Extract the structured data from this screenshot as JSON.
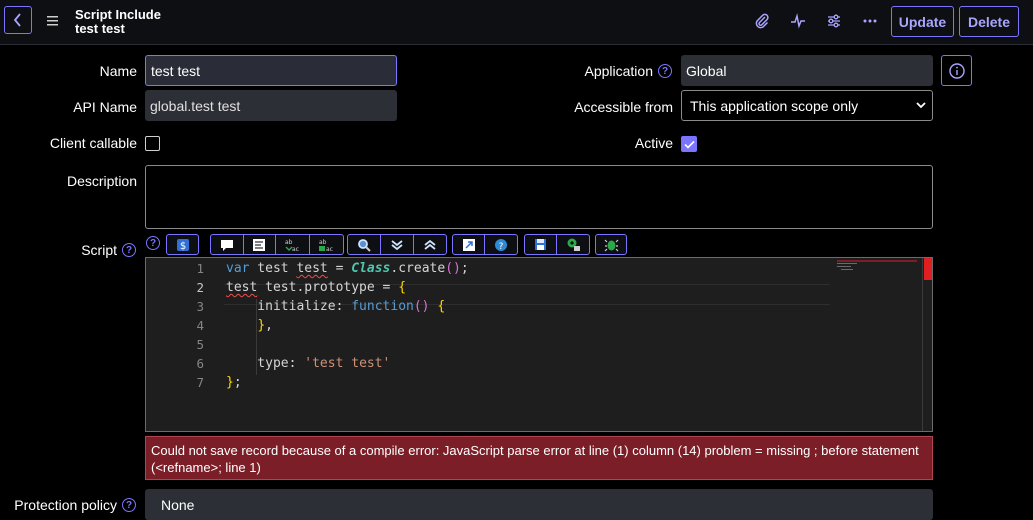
{
  "header": {
    "back_label": "Back",
    "title": "Script Include",
    "record": "test test",
    "update_label": "Update",
    "delete_label": "Delete",
    "icons": [
      "attachment-icon",
      "activity-icon",
      "settings-sliders-icon",
      "more-icon"
    ]
  },
  "form": {
    "name_label": "Name",
    "name_value": "test test",
    "api_name_label": "API Name",
    "api_name_value": "global.test test",
    "client_callable_label": "Client callable",
    "client_callable_checked": false,
    "description_label": "Description",
    "description_value": "",
    "application_label": "Application",
    "application_value": "Global",
    "accessible_from_label": "Accessible from",
    "accessible_from_value": "This application scope only",
    "active_label": "Active",
    "active_checked": true,
    "script_label": "Script",
    "protection_label": "Protection policy",
    "protection_value": "None"
  },
  "editor": {
    "lines": [
      "1",
      "2",
      "3",
      "4",
      "5",
      "6",
      "7"
    ],
    "code": [
      "var test test = Class.create();",
      "test test.prototype = {",
      "    initialize: function() {",
      "    },",
      "",
      "    type: 'test test'",
      "};"
    ]
  },
  "error": {
    "message": "Could not save record because of a compile error: JavaScript parse error at line (1) column (14) problem = missing ; before statement (<refname>; line 1)"
  },
  "colors": {
    "accent": "#7a74ff",
    "error_bg": "#7b1e27",
    "input_bg": "#2c2f35"
  }
}
